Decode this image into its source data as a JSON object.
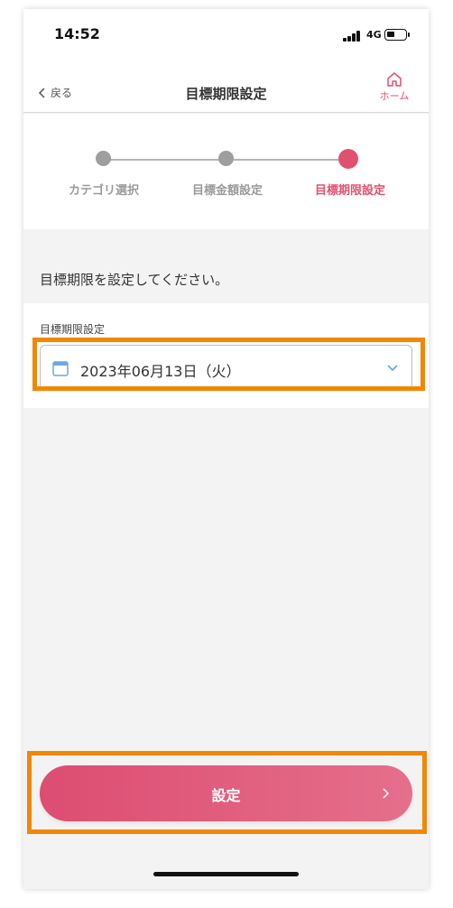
{
  "status_bar": {
    "time": "14:52",
    "network": "4G"
  },
  "nav": {
    "back_label": "戻る",
    "title": "目標期限設定",
    "home_label": "ホーム"
  },
  "stepper": {
    "steps": [
      {
        "label": "カテゴリ選択",
        "state": "done"
      },
      {
        "label": "目標金額設定",
        "state": "done"
      },
      {
        "label": "目標期限設定",
        "state": "active"
      }
    ]
  },
  "main": {
    "instruction": "目標期限を設定してください。",
    "field_label": "目標期限設定",
    "date_value": "2023年06月13日（火）"
  },
  "footer": {
    "set_label": "設定"
  },
  "icons": {
    "back": "chevron-left-icon",
    "home": "home-icon",
    "calendar": "calendar-icon",
    "dropdown": "chevron-down-icon",
    "next": "chevron-right-icon"
  },
  "colors": {
    "accent": "#e0516f",
    "inactive_step": "#9e9e9e",
    "background": "#f3f3f3",
    "highlight": "#f28705"
  }
}
